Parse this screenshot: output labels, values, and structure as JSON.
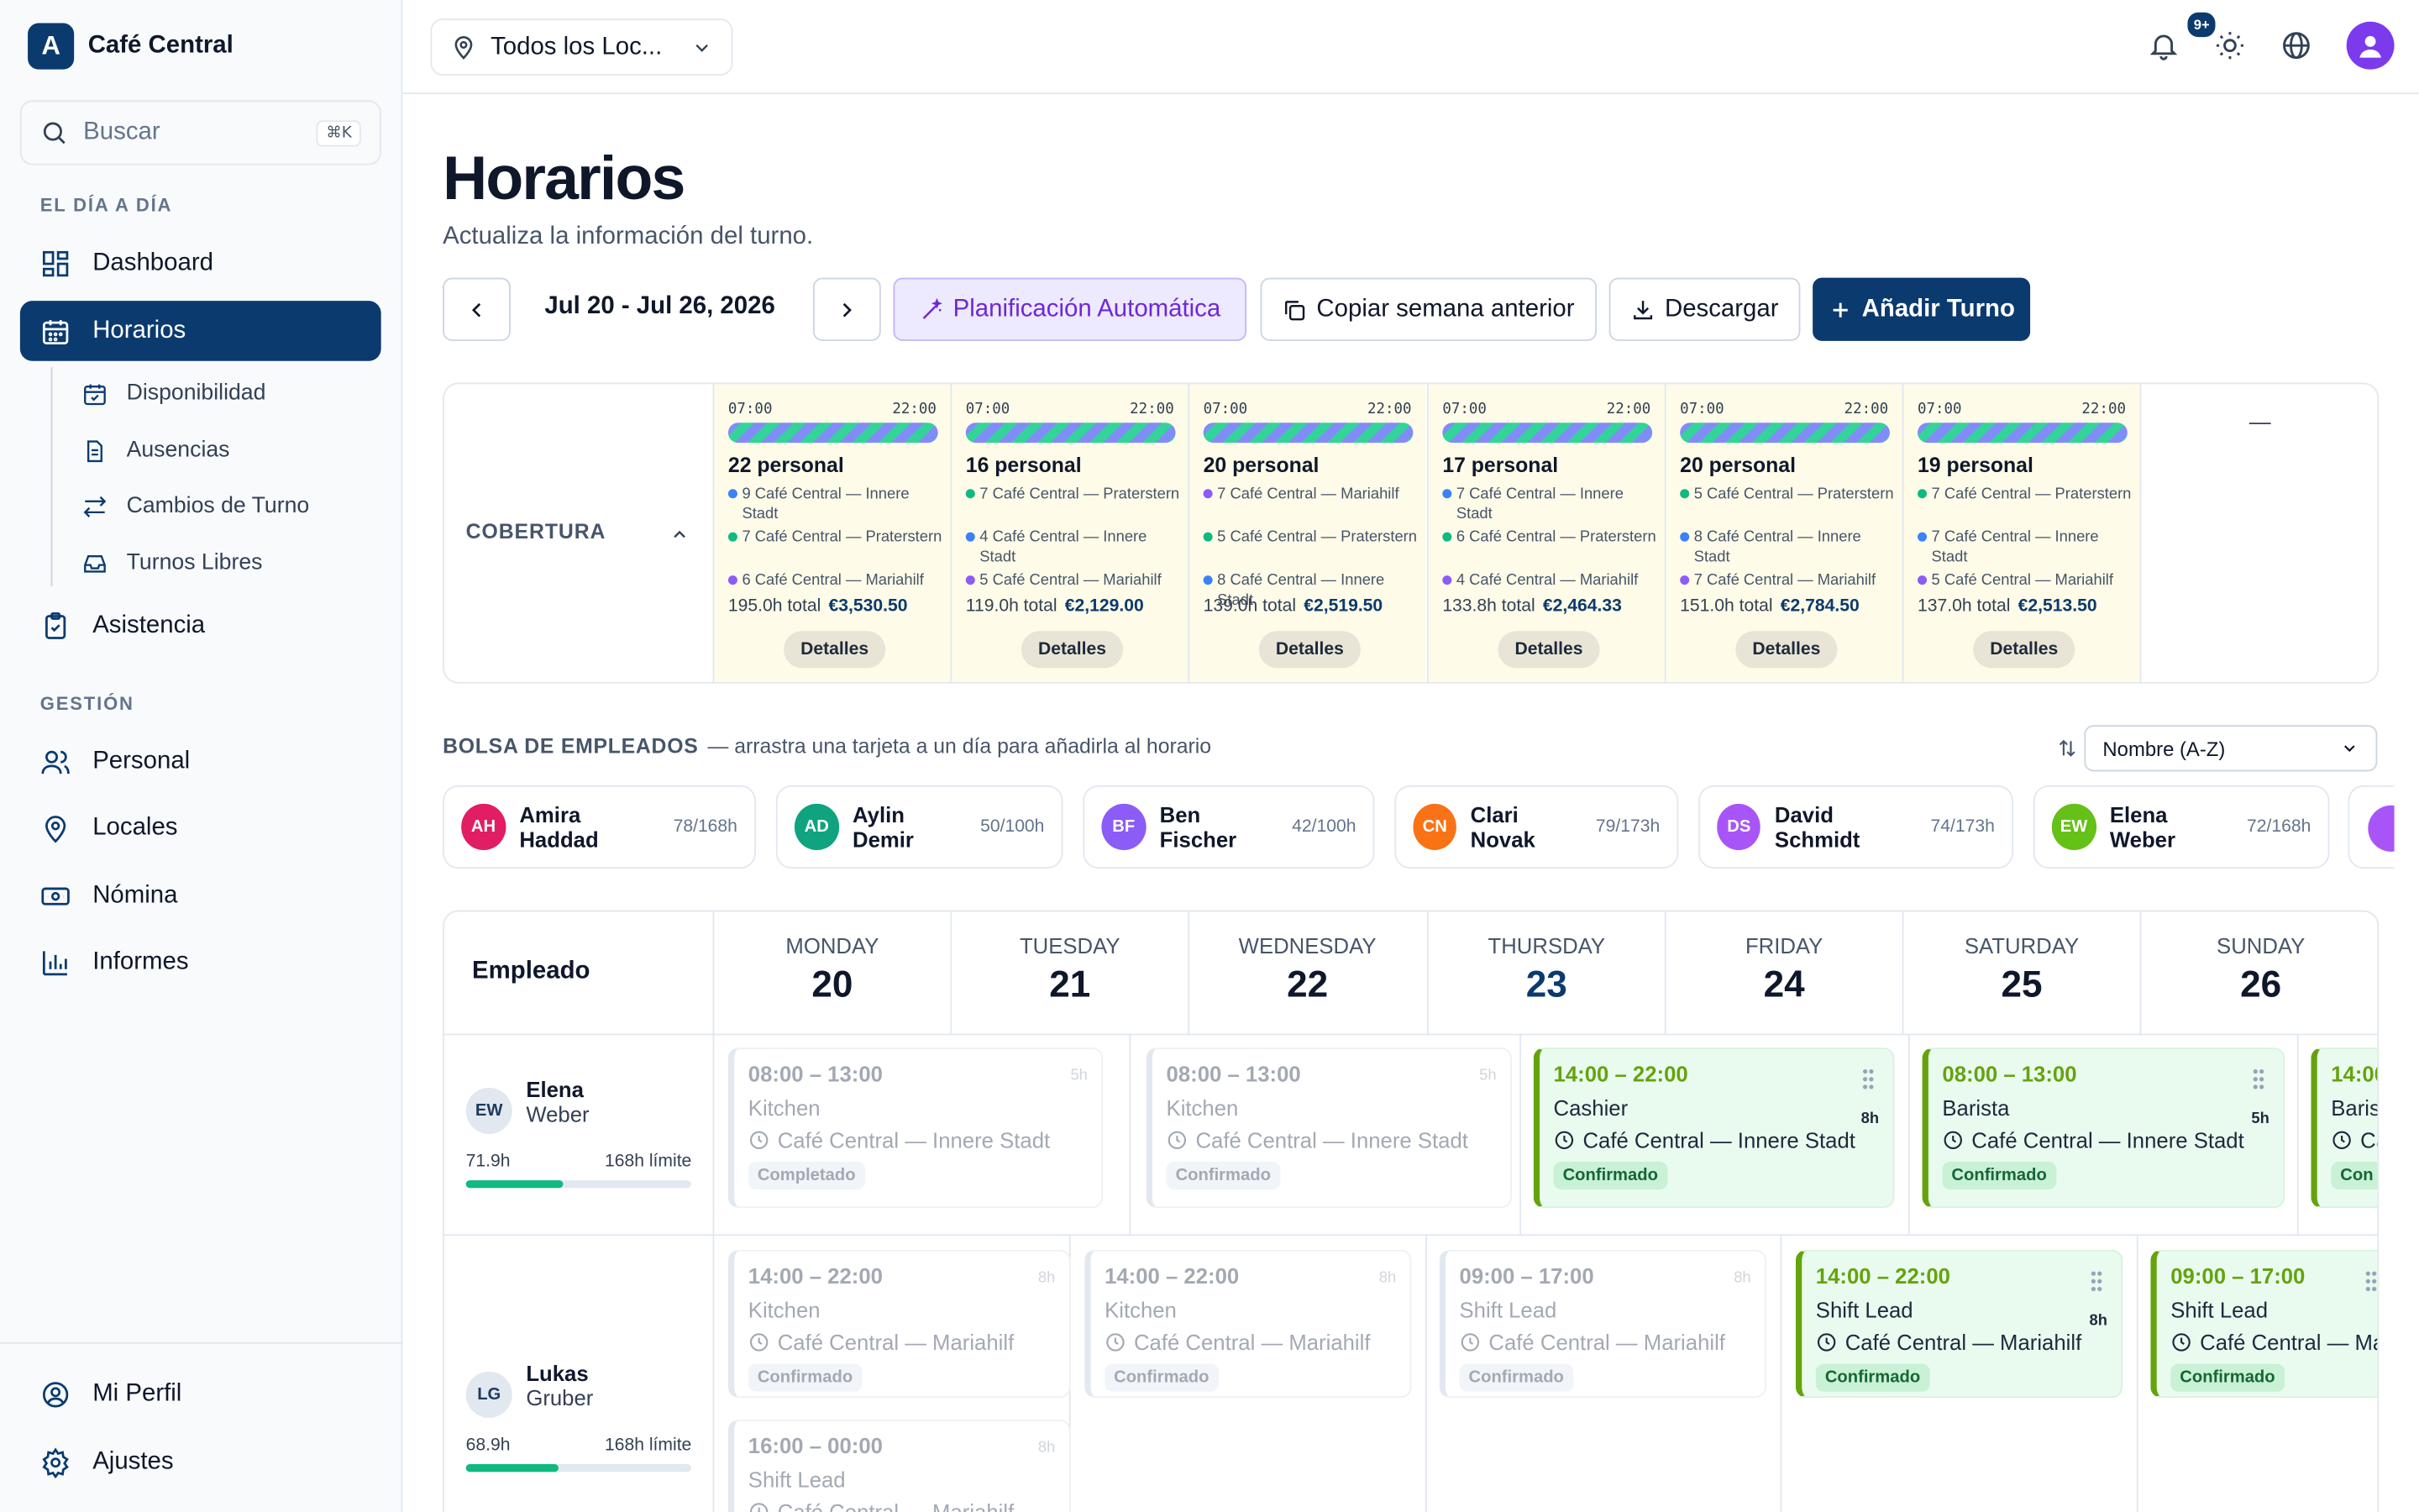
{
  "app": {
    "logo": "A",
    "name": "Café Central"
  },
  "search": {
    "placeholder": "Buscar",
    "shortcut": "⌘K"
  },
  "sidebar": {
    "section_daily": "EL DÍA A DÍA",
    "section_mgmt": "GESTIÓN",
    "items": [
      {
        "label": "Dashboard",
        "icon": "dashboard-icon"
      },
      {
        "label": "Horarios",
        "icon": "calendar-icon",
        "active": true
      },
      {
        "label": "Disponibilidad",
        "icon": "calendar-check-icon"
      },
      {
        "label": "Ausencias",
        "icon": "document-icon"
      },
      {
        "label": "Cambios de Turno",
        "icon": "swap-icon"
      },
      {
        "label": "Turnos Libres",
        "icon": "inbox-icon"
      },
      {
        "label": "Asistencia",
        "icon": "clipboard-check-icon"
      },
      {
        "label": "Personal",
        "icon": "users-icon"
      },
      {
        "label": "Locales",
        "icon": "map-pin-icon"
      },
      {
        "label": "Nómina",
        "icon": "banknote-icon"
      },
      {
        "label": "Informes",
        "icon": "bar-chart-icon"
      }
    ],
    "footer": [
      {
        "label": "Mi Perfil",
        "icon": "user-circle-icon"
      },
      {
        "label": "Ajustes",
        "icon": "gear-icon"
      }
    ]
  },
  "topbar": {
    "location": "Todos los Loc...",
    "notifications_badge": "9+"
  },
  "page": {
    "title": "Horarios",
    "subtitle": "Actualiza la información del turno."
  },
  "toolbar": {
    "date_range": "Jul 20 - Jul 26, 2026",
    "auto_plan": "Planificación Automática",
    "copy_week": "Copiar semana anterior",
    "download": "Descargar",
    "add_shift": "Añadir Turno"
  },
  "coverage": {
    "label": "COBERTURA",
    "start": "07:00",
    "end": "22:00",
    "details_label": "Detalles",
    "empty_day": "—",
    "days": [
      {
        "staff": "22 personal",
        "locations": [
          {
            "text": "9 Café Central — Innere Stadt",
            "color": "#3b82f6"
          },
          {
            "text": "7 Café Central — Praterstern",
            "color": "#10b981"
          },
          {
            "text": "6 Café Central — Mariahilf",
            "color": "#8b5cf6"
          }
        ],
        "hours": "195.0h total",
        "cost": "€3,530.50"
      },
      {
        "staff": "16 personal",
        "locations": [
          {
            "text": "7 Café Central — Praterstern",
            "color": "#10b981"
          },
          {
            "text": "4 Café Central — Innere Stadt",
            "color": "#3b82f6"
          },
          {
            "text": "5 Café Central — Mariahilf",
            "color": "#8b5cf6"
          }
        ],
        "hours": "119.0h total",
        "cost": "€2,129.00"
      },
      {
        "staff": "20 personal",
        "locations": [
          {
            "text": "7 Café Central — Mariahilf",
            "color": "#8b5cf6"
          },
          {
            "text": "5 Café Central — Praterstern",
            "color": "#10b981"
          },
          {
            "text": "8 Café Central — Innere Stadt",
            "color": "#3b82f6"
          }
        ],
        "hours": "139.0h total",
        "cost": "€2,519.50"
      },
      {
        "staff": "17 personal",
        "locations": [
          {
            "text": "7 Café Central — Innere Stadt",
            "color": "#3b82f6"
          },
          {
            "text": "6 Café Central — Praterstern",
            "color": "#10b981"
          },
          {
            "text": "4 Café Central — Mariahilf",
            "color": "#8b5cf6"
          }
        ],
        "hours": "133.8h total",
        "cost": "€2,464.33"
      },
      {
        "staff": "20 personal",
        "locations": [
          {
            "text": "5 Café Central — Praterstern",
            "color": "#10b981"
          },
          {
            "text": "8 Café Central — Innere Stadt",
            "color": "#3b82f6"
          },
          {
            "text": "7 Café Central — Mariahilf",
            "color": "#8b5cf6"
          }
        ],
        "hours": "151.0h total",
        "cost": "€2,784.50"
      },
      {
        "staff": "19 personal",
        "locations": [
          {
            "text": "7 Café Central — Praterstern",
            "color": "#10b981"
          },
          {
            "text": "7 Café Central — Innere Stadt",
            "color": "#3b82f6"
          },
          {
            "text": "5 Café Central — Mariahilf",
            "color": "#8b5cf6"
          }
        ],
        "hours": "137.0h total",
        "cost": "€2,513.50"
      }
    ]
  },
  "pool": {
    "title": "BOLSA DE EMPLEADOS",
    "hint": "— arrastra una tarjeta a un día para añadirla al horario",
    "sort": "Nombre (A-Z)",
    "employees": [
      {
        "initials": "AH",
        "name": "Amira Haddad",
        "hours": "78/168h",
        "color": "#e11d63"
      },
      {
        "initials": "AD",
        "name": "Aylin Demir",
        "hours": "50/100h",
        "color": "#10a37f"
      },
      {
        "initials": "BF",
        "name": "Ben Fischer",
        "hours": "42/100h",
        "color": "#8b5cf6"
      },
      {
        "initials": "CN",
        "name": "Clari Novak",
        "hours": "79/173h",
        "color": "#f97316"
      },
      {
        "initials": "DS",
        "name": "David Schmidt",
        "hours": "74/173h",
        "color": "#a855f7"
      },
      {
        "initials": "EW",
        "name": "Elena Weber",
        "hours": "72/168h",
        "color": "#65c018"
      }
    ]
  },
  "schedule": {
    "employee_header": "Empleado",
    "days": [
      {
        "name": "MONDAY",
        "num": "20"
      },
      {
        "name": "TUESDAY",
        "num": "21"
      },
      {
        "name": "WEDNESDAY",
        "num": "22"
      },
      {
        "name": "THURSDAY",
        "num": "23",
        "today": true
      },
      {
        "name": "FRIDAY",
        "num": "24"
      },
      {
        "name": "SATURDAY",
        "num": "25"
      },
      {
        "name": "SUNDAY",
        "num": "26"
      }
    ],
    "employees": [
      {
        "initials": "EW",
        "first": "Elena",
        "last": "Weber",
        "hours": "71.9h",
        "limit": "168h límite",
        "progress": 0.43
      },
      {
        "initials": "LG",
        "first": "Lukas",
        "last": "Gruber",
        "hours": "68.9h",
        "limit": "168h límite",
        "progress": 0.41
      }
    ],
    "shifts": [
      {
        "time": "08:00 – 13:00",
        "role": "Kitchen",
        "location": "Café Central — Innere Stadt",
        "status": "Completado",
        "duration": "5h"
      },
      {
        "time": "08:00 – 13:00",
        "role": "Kitchen",
        "location": "Café Central — Innere Stadt",
        "status": "Confirmado",
        "duration": "5h"
      },
      {
        "time": "14:00 – 22:00",
        "role": "Cashier",
        "location": "Café Central — Innere Stadt",
        "status": "Confirmado",
        "duration": "8h"
      },
      {
        "time": "08:00 – 13:00",
        "role": "Barista",
        "location": "Café Central — Innere Stadt",
        "status": "Confirmado",
        "duration": "5h"
      },
      {
        "time": "14:00",
        "role": "Baris",
        "location": "Ca",
        "status": "Con",
        "duration": ""
      },
      {
        "time": "14:00 – 22:00",
        "role": "Kitchen",
        "location": "Café Central — Mariahilf",
        "status": "Confirmado",
        "duration": "8h"
      },
      {
        "time": "16:00 – 00:00",
        "role": "Shift Lead",
        "location": "Café Central — Mariahilf",
        "status": "",
        "duration": "8h"
      },
      {
        "time": "14:00 – 22:00",
        "role": "Kitchen",
        "location": "Café Central — Mariahilf",
        "status": "Confirmado",
        "duration": "8h"
      },
      {
        "time": "09:00 – 17:00",
        "role": "Shift Lead",
        "location": "Café Central — Mariahilf",
        "status": "Confirmado",
        "duration": "8h"
      },
      {
        "time": "14:00 – 22:00",
        "role": "Shift Lead",
        "location": "Café Central — Mariahilf",
        "status": "Confirmado",
        "duration": "8h"
      },
      {
        "time": "09:00 – 17:00",
        "role": "Shift Lead",
        "location": "Café Central — Ma",
        "status": "Confirmado",
        "duration": ""
      }
    ]
  },
  "colors": {
    "brand": "#0b3a6e",
    "coverage_bg": "#fefbe8",
    "active_shift": "#65a30d",
    "auto_plan_bg": "#ede9fe"
  }
}
